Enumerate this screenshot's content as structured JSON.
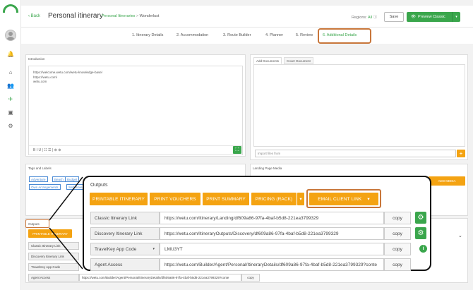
{
  "sidebar": {
    "icons": [
      {
        "name": "bell-icon",
        "glyph": "🔔"
      },
      {
        "name": "home-icon",
        "glyph": "⌂"
      },
      {
        "name": "users-icon",
        "glyph": "👥"
      },
      {
        "name": "send-icon",
        "glyph": "✈"
      },
      {
        "name": "image-icon",
        "glyph": "▣"
      },
      {
        "name": "settings-icon",
        "glyph": "⚙"
      }
    ]
  },
  "header": {
    "back": "Back",
    "title": "Personal itinerary",
    "crumb_parent": "Personal Itineraries",
    "crumb_sep": ">",
    "crumb_current": "Wonderlust",
    "regions_label": "Regions:",
    "regions_value": "All",
    "save": "Save",
    "preview": "Preview Classic",
    "preview_caret": "▾",
    "eye_glyph": "👁"
  },
  "tabs": [
    "1. Itinerary Details",
    "2. Accommodation",
    "3. Route Builder",
    "4. Planner",
    "5. Review",
    "6. Additional Details"
  ],
  "introduction": {
    "label": "Introduction",
    "lines": [
      "https://welcome.wetu.com/wetu-knowledge-base/",
      "https://wetu.com/",
      "wetu.com"
    ],
    "toolbar": "B  I  U  |  ☷  ☰  |  ⊗  ⊕",
    "expand": "⛶"
  },
  "documents": {
    "tab_add": "Add Documents",
    "tab_cover": "Cover Document",
    "import_placeholder": "Import files from",
    "plus": "+"
  },
  "tags": {
    "label": "Tags and Labels",
    "items": [
      "Adventure",
      "Beach",
      "Budget",
      "Own Arrangements",
      "Self Drive"
    ]
  },
  "landing": {
    "label": "Landing Page Media",
    "add_media": "ADD MEDIA"
  },
  "outputs_small": {
    "label": "Outputs",
    "button": "PRINTABLE ITINERARY",
    "rows": [
      {
        "label": "Classic Itinerary Link"
      },
      {
        "label": "Discovery Itinerary Link"
      },
      {
        "label": "TravelKey App Code"
      },
      {
        "label": "Agent Access",
        "value": "https://wetu.com/Builder/Agent/Personal/ItineraryDetails/df609a86-97fa-4baf-b5d8-221ea3799329?conte",
        "copy": "copy"
      }
    ]
  },
  "outputs": {
    "title": "Outputs",
    "buttons": [
      "PRINTABLE ITINERARY",
      "PRINT VOUCHERS",
      "PRINT SUMMARY",
      "PRICING (RACK)",
      "EMAIL CLIENT LINK"
    ],
    "split_caret": "▾",
    "email_caret": "▾",
    "rows": [
      {
        "label": "Classic Itinerary Link",
        "value": "https://wetu.com/Itinerary/Landing/df609a86-97fa-4baf-b5d8-221ea3799329",
        "copy": "copy",
        "extra": "gear"
      },
      {
        "label": "Discovery Itinerary Link",
        "value": "https://wetu.com/ItineraryOutputs/Discovery/df609a86-97fa-4baf-b5d8-221ea3799329",
        "copy": "copy",
        "extra": "gear"
      },
      {
        "label": "TravelKey App Code",
        "value": "LMU3YT",
        "copy": "copy",
        "extra": "info",
        "caret": "▾"
      },
      {
        "label": "Agent Access",
        "value": "https://wetu.com/Builder/Agent/Personal/ItineraryDetails/df609a86-97fa-4baf-b5d8-221ea3799329?conte",
        "copy": "copy",
        "extra": ""
      }
    ],
    "gear_glyph": "⚙",
    "info_glyph": "i"
  },
  "colors": {
    "brand_green": "#3aa64c",
    "orange": "#f4a312",
    "highlight": "#c8763a"
  }
}
